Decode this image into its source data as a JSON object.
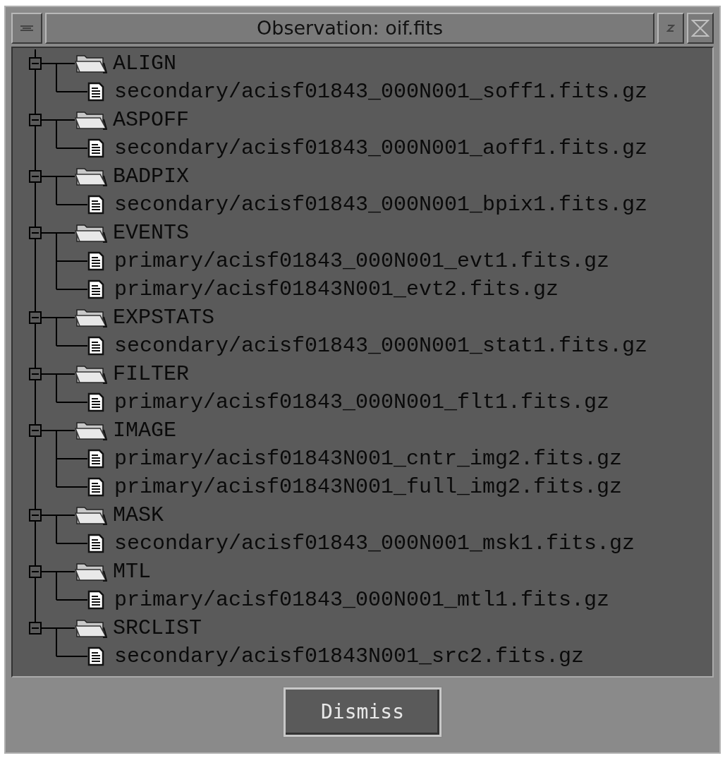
{
  "window": {
    "title": "Observation: oif.fits"
  },
  "tree": [
    {
      "label": "ALIGN",
      "expanded": true,
      "children": [
        {
          "label": "secondary/acisf01843_000N001_soff1.fits.gz"
        }
      ]
    },
    {
      "label": "ASPOFF",
      "expanded": true,
      "children": [
        {
          "label": "secondary/acisf01843_000N001_aoff1.fits.gz"
        }
      ]
    },
    {
      "label": "BADPIX",
      "expanded": true,
      "children": [
        {
          "label": "secondary/acisf01843_000N001_bpix1.fits.gz"
        }
      ]
    },
    {
      "label": "EVENTS",
      "expanded": true,
      "children": [
        {
          "label": "primary/acisf01843_000N001_evt1.fits.gz"
        },
        {
          "label": "primary/acisf01843N001_evt2.fits.gz"
        }
      ]
    },
    {
      "label": "EXPSTATS",
      "expanded": true,
      "children": [
        {
          "label": "secondary/acisf01843_000N001_stat1.fits.gz"
        }
      ]
    },
    {
      "label": "FILTER",
      "expanded": true,
      "children": [
        {
          "label": "primary/acisf01843_000N001_flt1.fits.gz"
        }
      ]
    },
    {
      "label": "IMAGE",
      "expanded": true,
      "children": [
        {
          "label": "primary/acisf01843N001_cntr_img2.fits.gz"
        },
        {
          "label": "primary/acisf01843N001_full_img2.fits.gz"
        }
      ]
    },
    {
      "label": "MASK",
      "expanded": true,
      "children": [
        {
          "label": "secondary/acisf01843_000N001_msk1.fits.gz"
        }
      ]
    },
    {
      "label": "MTL",
      "expanded": true,
      "children": [
        {
          "label": "primary/acisf01843_000N001_mtl1.fits.gz"
        }
      ]
    },
    {
      "label": "SRCLIST",
      "expanded": true,
      "children": [
        {
          "label": "secondary/acisf01843N001_src2.fits.gz"
        }
      ]
    }
  ],
  "buttons": [
    {
      "label": "Dismiss"
    }
  ]
}
